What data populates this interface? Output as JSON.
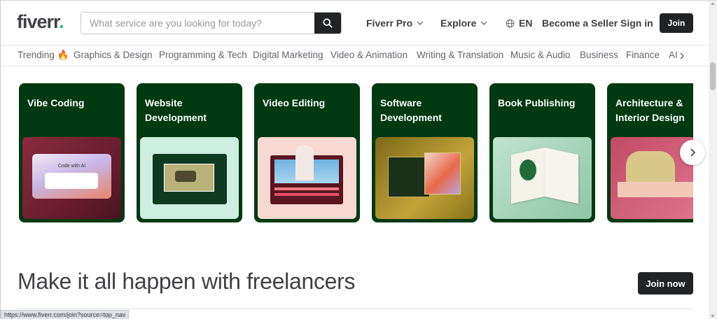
{
  "header": {
    "logo_text": "fiverr",
    "logo_dot": ".",
    "search_placeholder": "What service are you looking for today?",
    "fiverr_pro": "Fiverr Pro",
    "explore": "Explore",
    "language": "EN",
    "become_seller": "Become a Seller",
    "sign_in": "Sign in",
    "join": "Join"
  },
  "categories": {
    "items": [
      "Trending 🔥",
      "Graphics & Design",
      "Programming & Tech",
      "Digital Marketing",
      "Video & Animation",
      "Writing & Translation",
      "Music & Audio",
      "Business",
      "Finance",
      "AI"
    ]
  },
  "cards": [
    {
      "title": "Vibe Coding",
      "image_text": "Code with AI"
    },
    {
      "title": "Website Development"
    },
    {
      "title": "Video Editing"
    },
    {
      "title": "Software Development"
    },
    {
      "title": "Book Publishing"
    },
    {
      "title": "Architecture & Interior Design"
    }
  ],
  "main": {
    "headline": "Make it all happen with freelancers",
    "join_now": "Join now"
  },
  "status": {
    "url": "https://www.fiverr.com/join?source=top_nav"
  },
  "colors": {
    "brand_green": "#1dbf73",
    "card_bg": "#003912",
    "dark_button": "#222325"
  }
}
